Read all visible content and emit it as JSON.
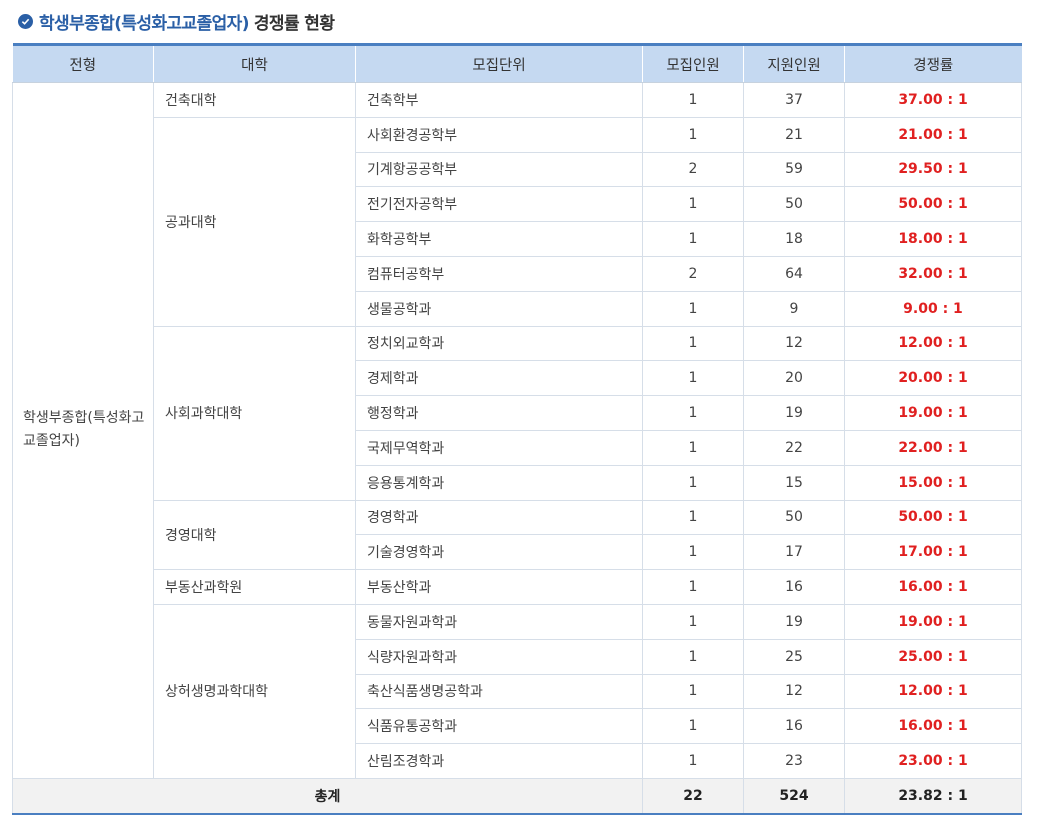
{
  "title": {
    "part1": "학생부종합(특성화고교졸업자)",
    "part2": "경쟁률 현황",
    "icon": "check-circle-icon"
  },
  "headers": [
    "전형",
    "대학",
    "모집단위",
    "모집인원",
    "지원인원",
    "경쟁률"
  ],
  "admission_type": "학생부종합(특성화고교졸업자)",
  "colleges": [
    {
      "name": "건축대학",
      "rows": [
        {
          "unit": "건축학부",
          "quota": "1",
          "applicants": "37",
          "rate": "37.00 : 1"
        }
      ]
    },
    {
      "name": "공과대학",
      "rows": [
        {
          "unit": "사회환경공학부",
          "quota": "1",
          "applicants": "21",
          "rate": "21.00 : 1"
        },
        {
          "unit": "기계항공공학부",
          "quota": "2",
          "applicants": "59",
          "rate": "29.50 : 1"
        },
        {
          "unit": "전기전자공학부",
          "quota": "1",
          "applicants": "50",
          "rate": "50.00 : 1"
        },
        {
          "unit": "화학공학부",
          "quota": "1",
          "applicants": "18",
          "rate": "18.00 : 1"
        },
        {
          "unit": "컴퓨터공학부",
          "quota": "2",
          "applicants": "64",
          "rate": "32.00 : 1"
        },
        {
          "unit": "생물공학과",
          "quota": "1",
          "applicants": "9",
          "rate": "9.00 : 1"
        }
      ]
    },
    {
      "name": "사회과학대학",
      "rows": [
        {
          "unit": "정치외교학과",
          "quota": "1",
          "applicants": "12",
          "rate": "12.00 : 1"
        },
        {
          "unit": "경제학과",
          "quota": "1",
          "applicants": "20",
          "rate": "20.00 : 1"
        },
        {
          "unit": "행정학과",
          "quota": "1",
          "applicants": "19",
          "rate": "19.00 : 1"
        },
        {
          "unit": "국제무역학과",
          "quota": "1",
          "applicants": "22",
          "rate": "22.00 : 1"
        },
        {
          "unit": "응용통계학과",
          "quota": "1",
          "applicants": "15",
          "rate": "15.00 : 1"
        }
      ]
    },
    {
      "name": "경영대학",
      "rows": [
        {
          "unit": "경영학과",
          "quota": "1",
          "applicants": "50",
          "rate": "50.00 : 1"
        },
        {
          "unit": "기술경영학과",
          "quota": "1",
          "applicants": "17",
          "rate": "17.00 : 1"
        }
      ]
    },
    {
      "name": "부동산과학원",
      "rows": [
        {
          "unit": "부동산학과",
          "quota": "1",
          "applicants": "16",
          "rate": "16.00 : 1"
        }
      ]
    },
    {
      "name": "상허생명과학대학",
      "rows": [
        {
          "unit": "동물자원과학과",
          "quota": "1",
          "applicants": "19",
          "rate": "19.00 : 1"
        },
        {
          "unit": "식량자원과학과",
          "quota": "1",
          "applicants": "25",
          "rate": "25.00 : 1"
        },
        {
          "unit": "축산식품생명공학과",
          "quota": "1",
          "applicants": "12",
          "rate": "12.00 : 1"
        },
        {
          "unit": "식품유통공학과",
          "quota": "1",
          "applicants": "16",
          "rate": "16.00 : 1"
        },
        {
          "unit": "산림조경학과",
          "quota": "1",
          "applicants": "23",
          "rate": "23.00 : 1"
        }
      ]
    }
  ],
  "total": {
    "label": "총계",
    "quota": "22",
    "applicants": "524",
    "rate": "23.82 : 1"
  },
  "colors": {
    "accent": "#2a5fa6",
    "header_bg": "#c5d9f1",
    "rate_red": "#e02020"
  }
}
